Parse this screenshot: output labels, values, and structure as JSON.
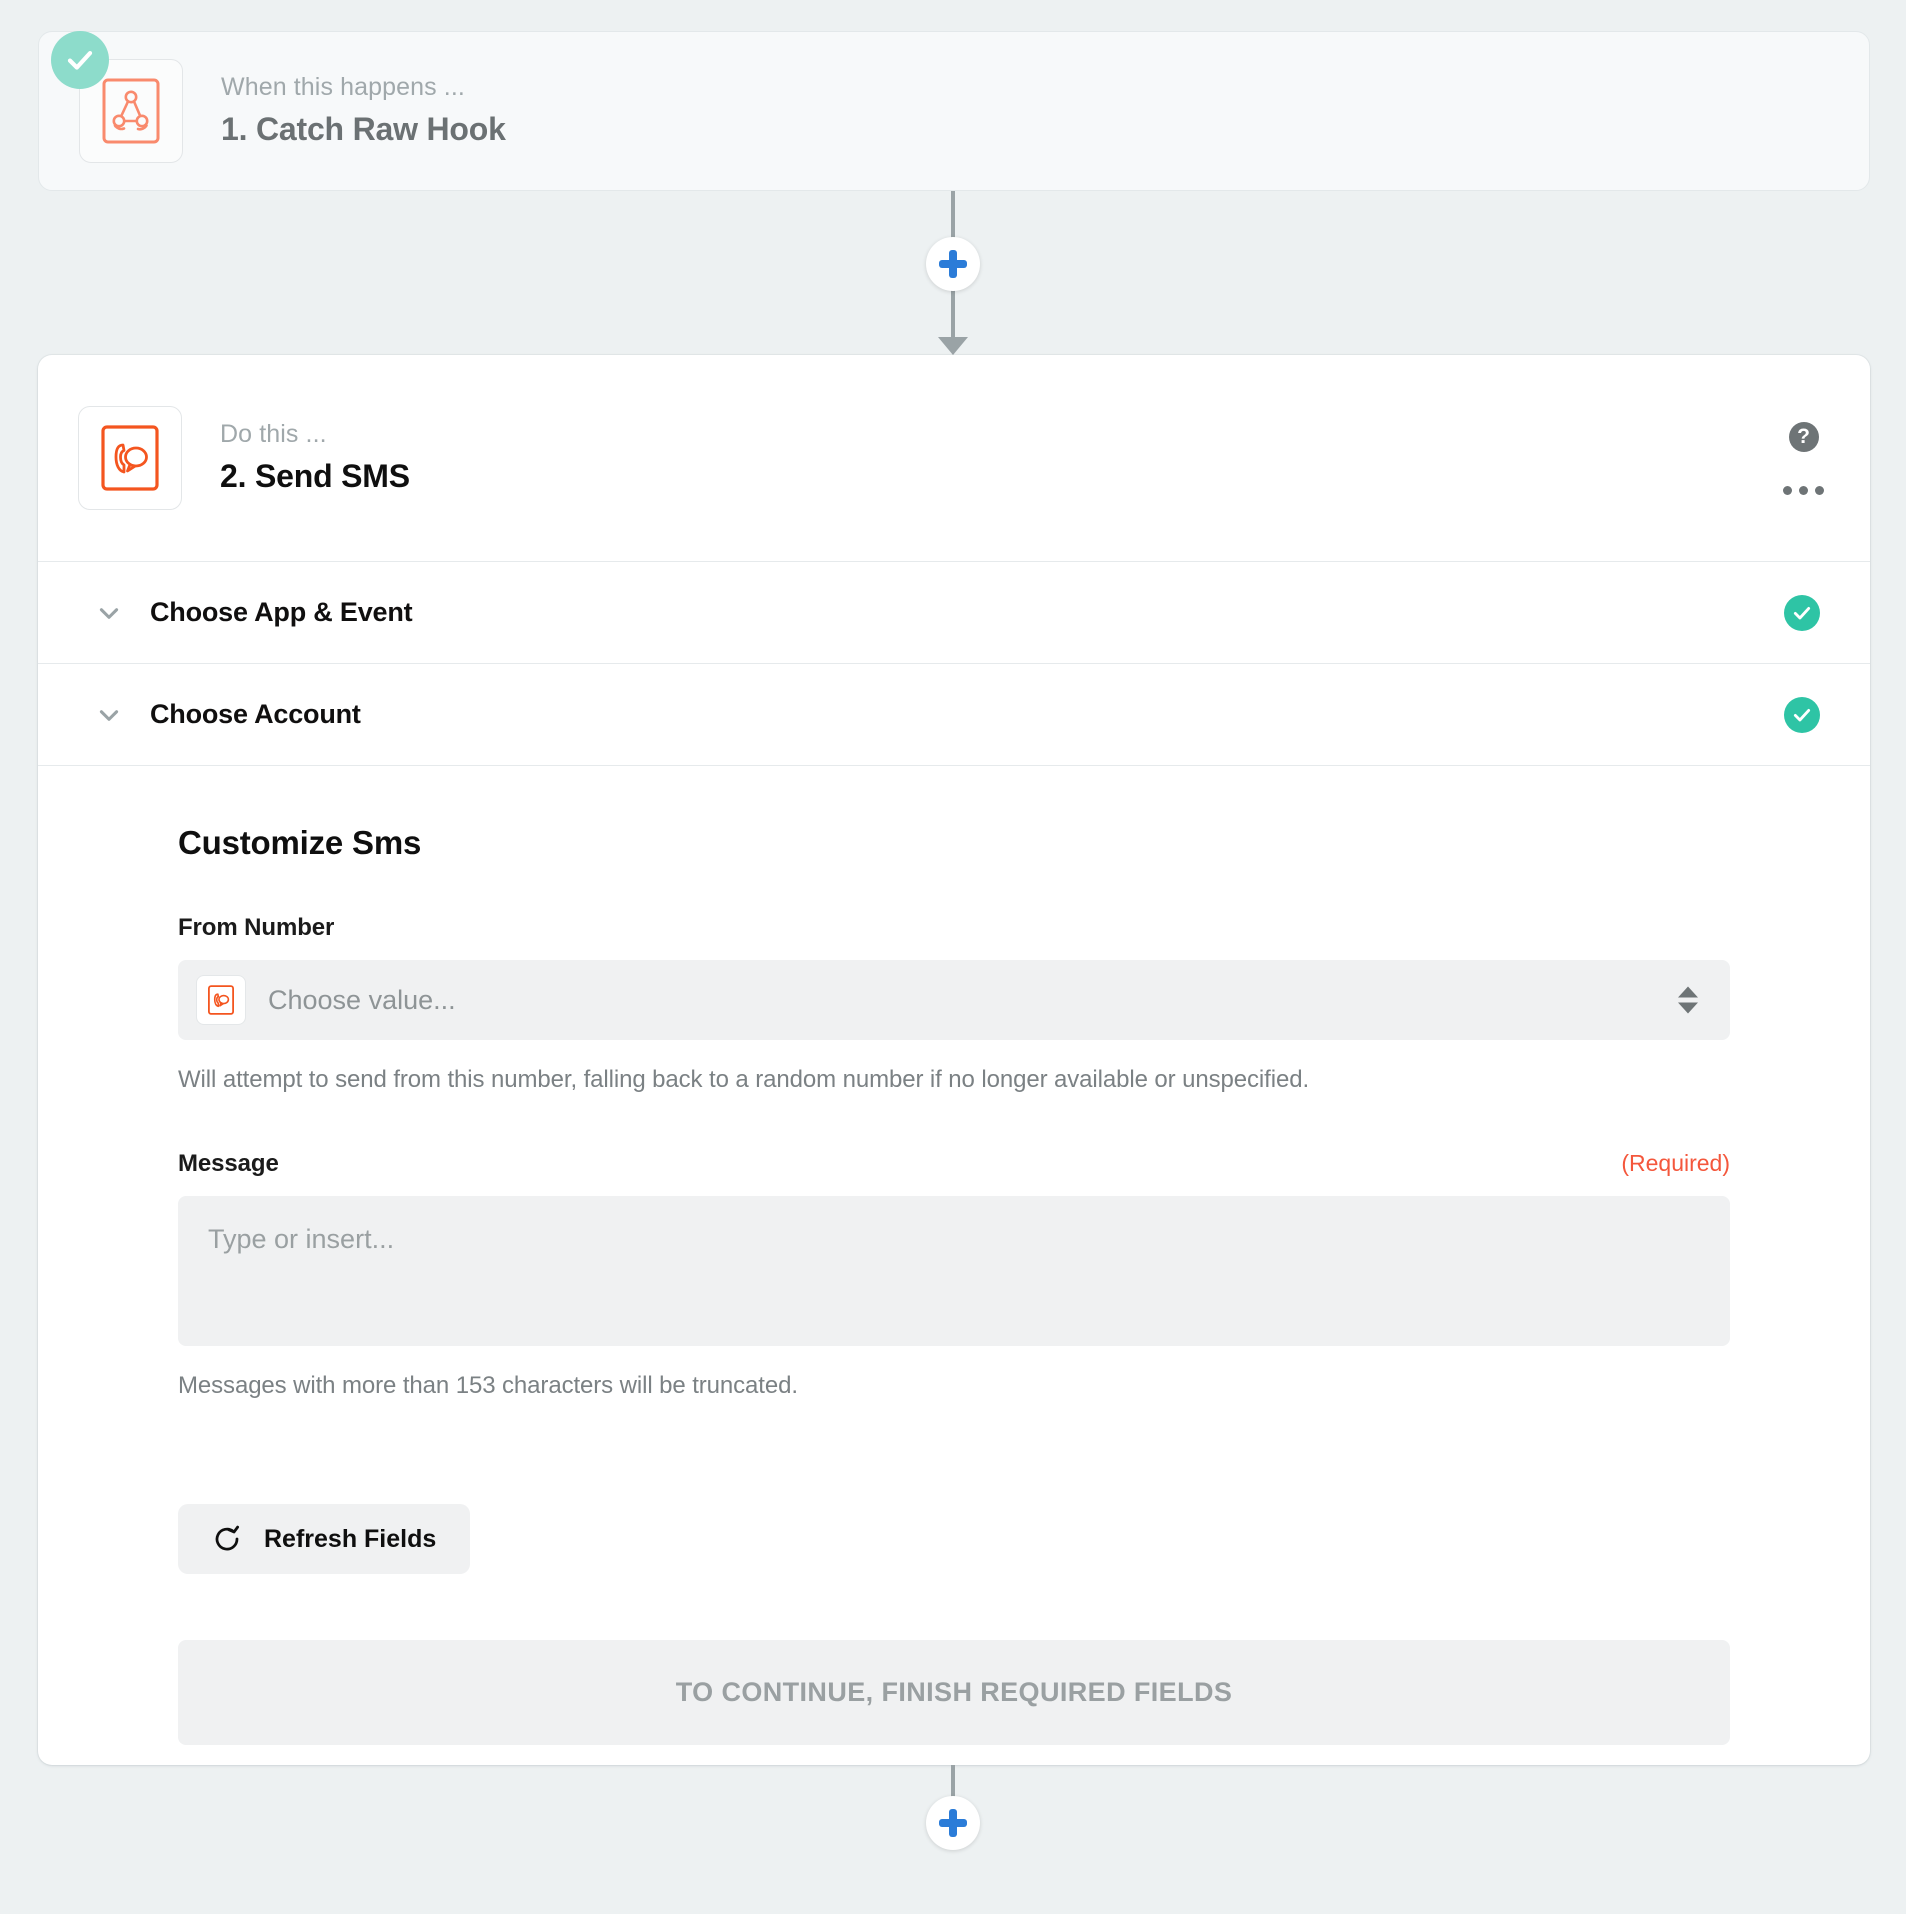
{
  "theme": {
    "page_bg": "#edf1f2",
    "accent_blue": "#2b7cd8",
    "accent_orange": "#f4573c",
    "success_green": "#2ec4a5",
    "success_green_muted": "#8ddccb"
  },
  "step1": {
    "eyebrow": "When this happens ...",
    "title": "1. Catch Raw Hook",
    "app_icon": "webhook-icon",
    "status_icon": "check-circle-icon"
  },
  "connector_top": {
    "add_step_icon": "plus-icon"
  },
  "connector_bottom": {
    "add_step_icon": "plus-icon"
  },
  "step2": {
    "eyebrow": "Do this ...",
    "title": "2. Send SMS",
    "app_icon": "sms-icon",
    "help_icon": "question-circle-icon",
    "more_icon": "ellipsis-icon",
    "sections": [
      {
        "label": "Choose App & Event",
        "chevron": "chevron-down-icon",
        "status_icon": "check-circle-icon"
      },
      {
        "label": "Choose Account",
        "chevron": "chevron-down-icon",
        "status_icon": "check-circle-icon"
      }
    ],
    "form": {
      "title": "Customize Sms",
      "from_number": {
        "label": "From Number",
        "placeholder": "Choose value...",
        "app_icon": "sms-icon",
        "spinner_icon": "sort-arrows-icon",
        "helper": "Will attempt to send from this number, falling back to a random number if no longer available or unspecified."
      },
      "message": {
        "label": "Message",
        "required_flag": "(Required)",
        "placeholder": "Type or insert...",
        "helper": "Messages with more than 153 characters will be truncated."
      },
      "refresh_button": {
        "label": "Refresh Fields",
        "icon": "refresh-icon"
      },
      "continue_button": {
        "label": "TO CONTINUE, FINISH REQUIRED FIELDS"
      }
    }
  }
}
